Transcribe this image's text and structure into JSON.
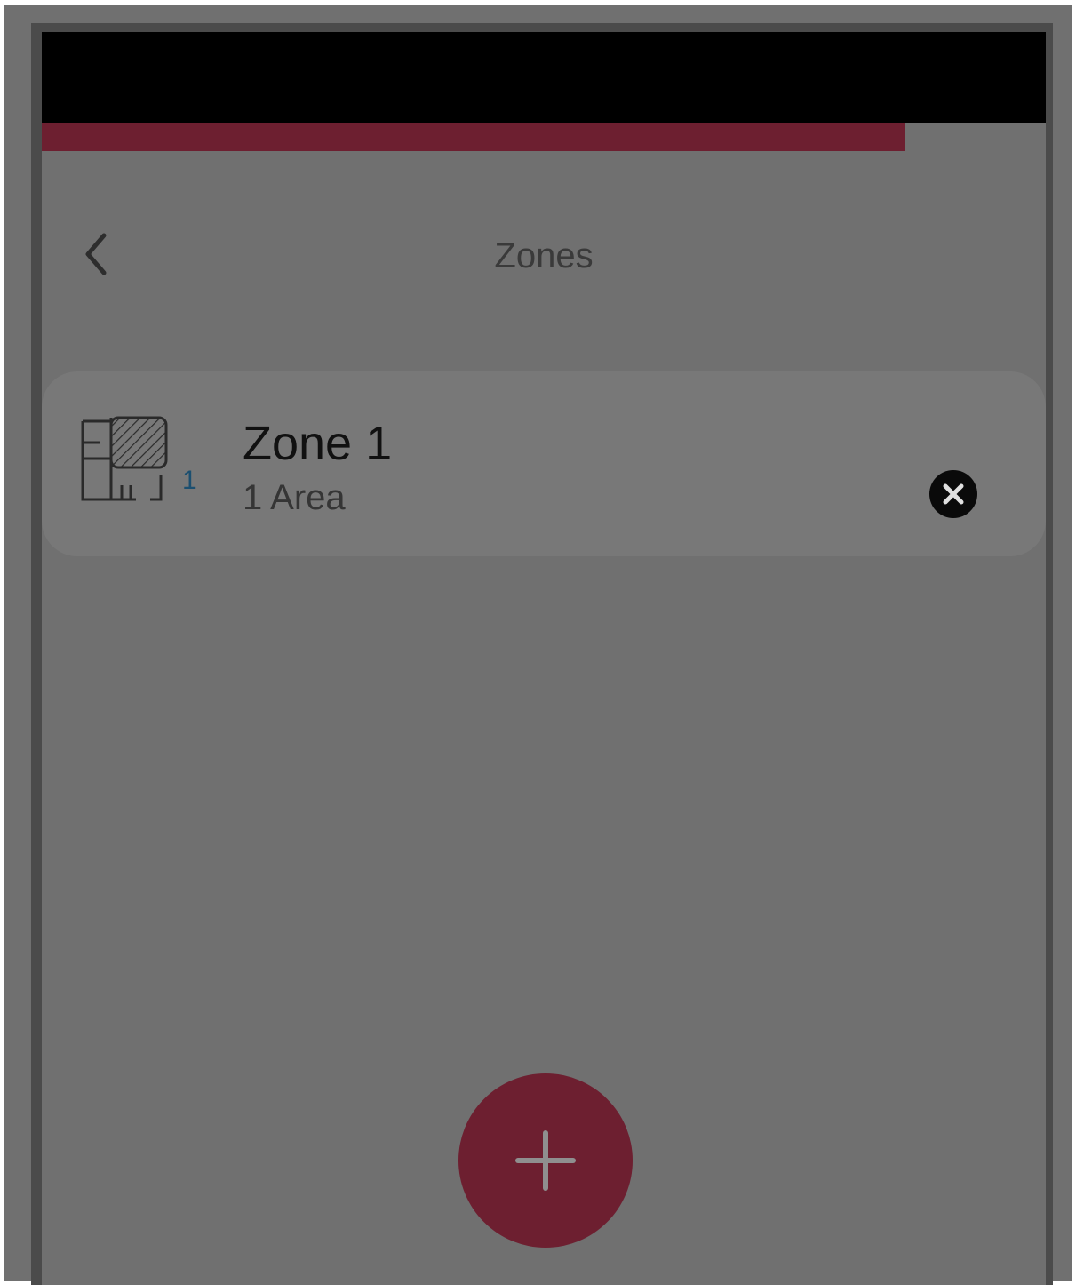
{
  "header": {
    "title": "Zones",
    "back_icon": "chevron-left-icon"
  },
  "progress": {
    "fraction": 0.86,
    "color": "#6d1f30"
  },
  "zones": [
    {
      "name": "Zone 1",
      "subtitle": "1 Area",
      "area_count": "1",
      "icon": "floor-plan-icon",
      "remove_icon": "close-circle-icon"
    }
  ],
  "fab": {
    "icon": "plus-icon",
    "color": "#6d1f30"
  }
}
